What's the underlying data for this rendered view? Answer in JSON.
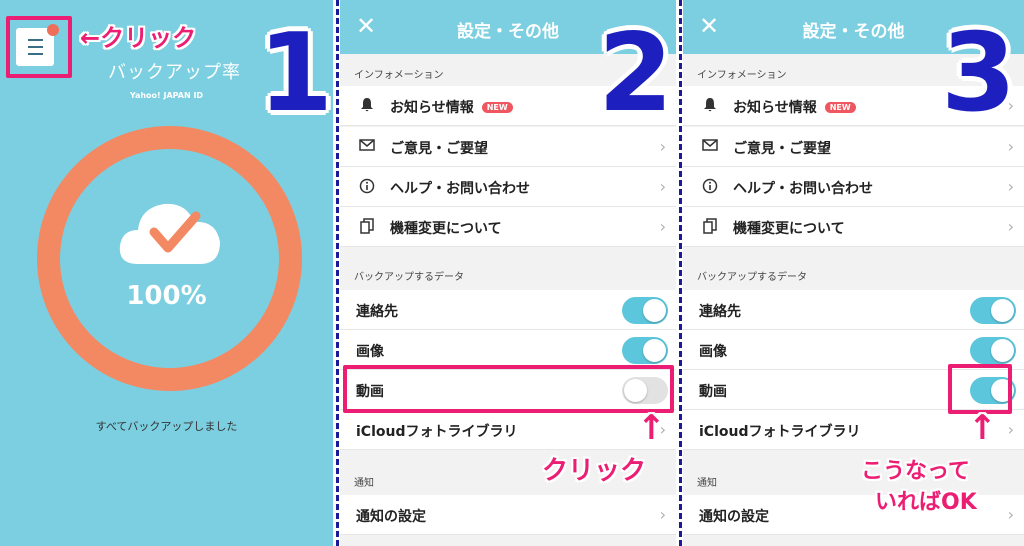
{
  "step1": {
    "number": "1",
    "title": "バックアップ率",
    "subtitle": "Yahoo! JAPAN ID",
    "percent": "100%",
    "status": "すべてバックアップしました",
    "annotation": "←クリック",
    "menu_icon": "hamburger-menu-icon",
    "accent_color": "#f28963",
    "bg_color": "#7ccfe0"
  },
  "settings": {
    "header_title": "設定・その他",
    "close_label": "✕",
    "section_info": "インフォメーション",
    "info_items": [
      {
        "label": "お知らせ情報",
        "icon": "bell-icon",
        "badge": "NEW"
      },
      {
        "label": "ご意見・ご要望",
        "icon": "mail-icon"
      },
      {
        "label": "ヘルプ・お問い合わせ",
        "icon": "info-icon"
      },
      {
        "label": "機種変更について",
        "icon": "copy-icon"
      }
    ],
    "section_data": "バックアップするデータ",
    "data_items": [
      {
        "label": "連絡先"
      },
      {
        "label": "画像"
      },
      {
        "label": "動画"
      },
      {
        "label": "iCloudフォトライブラリ"
      }
    ],
    "section_notify": "通知",
    "notify_items": [
      {
        "label": "通知の設定"
      }
    ]
  },
  "step2": {
    "number": "2",
    "annotation": "クリック",
    "toggles": {
      "contacts": true,
      "images": true,
      "video": false
    }
  },
  "step3": {
    "number": "3",
    "annotation_line1": "こうなって",
    "annotation_line2": "いればOK",
    "toggles": {
      "contacts": true,
      "images": true,
      "video": true
    }
  },
  "arrow_glyph": "↑",
  "chevron_glyph": "›",
  "colors": {
    "highlight": "#ec1e73",
    "step_number": "#1d1fbe",
    "toggle_on": "#5cc6dc"
  }
}
